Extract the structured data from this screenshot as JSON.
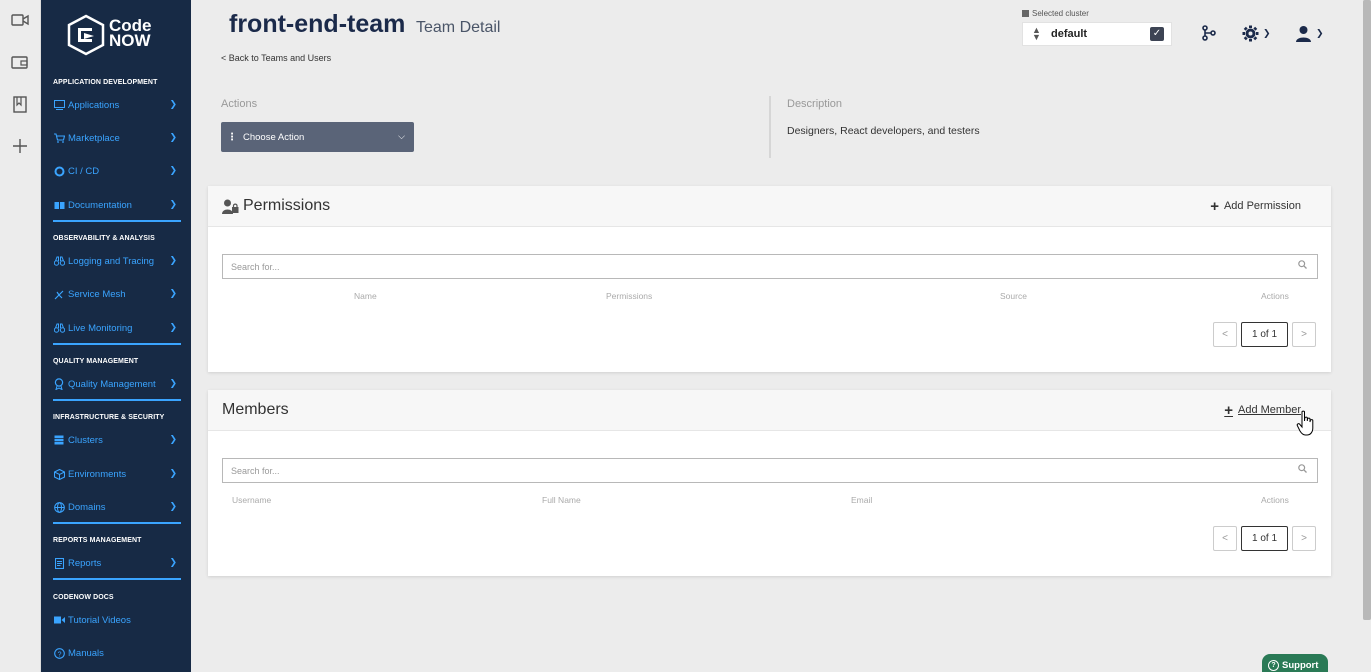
{
  "app": {
    "logo_line1": "Code",
    "logo_line2": "NOW"
  },
  "sidebar": {
    "sections": [
      {
        "title": "APPLICATION DEVELOPMENT",
        "items": [
          {
            "label": "Applications",
            "icon": "apps-icon"
          },
          {
            "label": "Marketplace",
            "icon": "cart-icon"
          },
          {
            "label": "CI / CD",
            "icon": "cicd-icon"
          },
          {
            "label": "Documentation",
            "icon": "book-icon"
          }
        ]
      },
      {
        "title": "OBSERVABILITY & ANALYSIS",
        "items": [
          {
            "label": "Logging and Tracing",
            "icon": "binoculars-icon"
          },
          {
            "label": "Service Mesh",
            "icon": "mesh-icon"
          },
          {
            "label": "Live Monitoring",
            "icon": "monitor-icon"
          }
        ]
      },
      {
        "title": "QUALITY MANAGEMENT",
        "items": [
          {
            "label": "Quality Management",
            "icon": "quality-icon"
          }
        ]
      },
      {
        "title": "INFRASTRUCTURE & SECURITY",
        "items": [
          {
            "label": "Clusters",
            "icon": "server-icon"
          },
          {
            "label": "Environments",
            "icon": "cube-icon"
          },
          {
            "label": "Domains",
            "icon": "globe-icon"
          }
        ]
      },
      {
        "title": "REPORTS MANAGEMENT",
        "items": [
          {
            "label": "Reports",
            "icon": "report-icon"
          }
        ]
      },
      {
        "title": "CODENOW DOCS",
        "items": [
          {
            "label": "Tutorial Videos",
            "icon": "video-icon"
          },
          {
            "label": "Manuals",
            "icon": "help-icon"
          }
        ]
      }
    ]
  },
  "header": {
    "title": "front-end-team",
    "subtitle": "Team Detail",
    "back_link": "< Back to Teams and Users",
    "cluster_label": "Selected cluster",
    "cluster_value": "default"
  },
  "actions": {
    "label": "Actions",
    "button": "Choose Action"
  },
  "description": {
    "label": "Description",
    "text": "Designers, React developers, and testers"
  },
  "permissions": {
    "title": "Permissions",
    "add_label": "Add Permission",
    "search_placeholder": "Search for...",
    "columns": [
      "Name",
      "Permissions",
      "Source",
      "Actions"
    ],
    "pager": {
      "prev": "<",
      "page": "1 of 1",
      "next": ">"
    }
  },
  "members": {
    "title": "Members",
    "add_label": "Add Member",
    "search_placeholder": "Search for...",
    "columns": [
      "Username",
      "Full Name",
      "Email",
      "Actions"
    ],
    "pager": {
      "prev": "<",
      "page": "1 of 1",
      "next": ">"
    }
  },
  "support": {
    "label": "Support"
  },
  "colors": {
    "sidebar_bg": "#172a45",
    "accent": "#3aa4ff",
    "support_bg": "#2a7a56"
  }
}
